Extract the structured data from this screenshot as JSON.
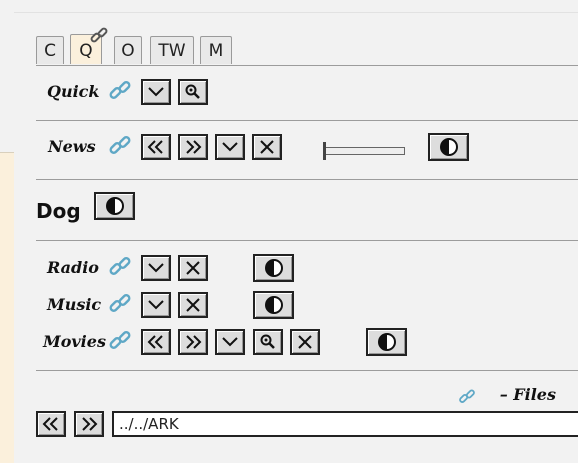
{
  "tabs": [
    {
      "label": "C",
      "active": false
    },
    {
      "label": "Q",
      "active": true
    },
    {
      "label": "O",
      "active": false
    },
    {
      "label": "TW",
      "active": false
    },
    {
      "label": "M",
      "active": false
    }
  ],
  "rows": {
    "quick": {
      "label": "Quick"
    },
    "news": {
      "label": "News",
      "slider_value": 0
    },
    "dog": {
      "label": "Dog"
    },
    "radio": {
      "label": "Radio"
    },
    "music": {
      "label": "Music"
    },
    "movies": {
      "label": "Movies"
    }
  },
  "files": {
    "label": "– Files",
    "path": "../../ARK"
  },
  "icons": [
    "link-icon",
    "chevron-down-icon",
    "zoom-icon",
    "double-left-icon",
    "double-right-icon",
    "close-icon",
    "contrast-icon"
  ],
  "colors": {
    "link": "#5fa8c6",
    "active_tab": "#fbf0dc",
    "side_panel": "#fbf0dc"
  }
}
